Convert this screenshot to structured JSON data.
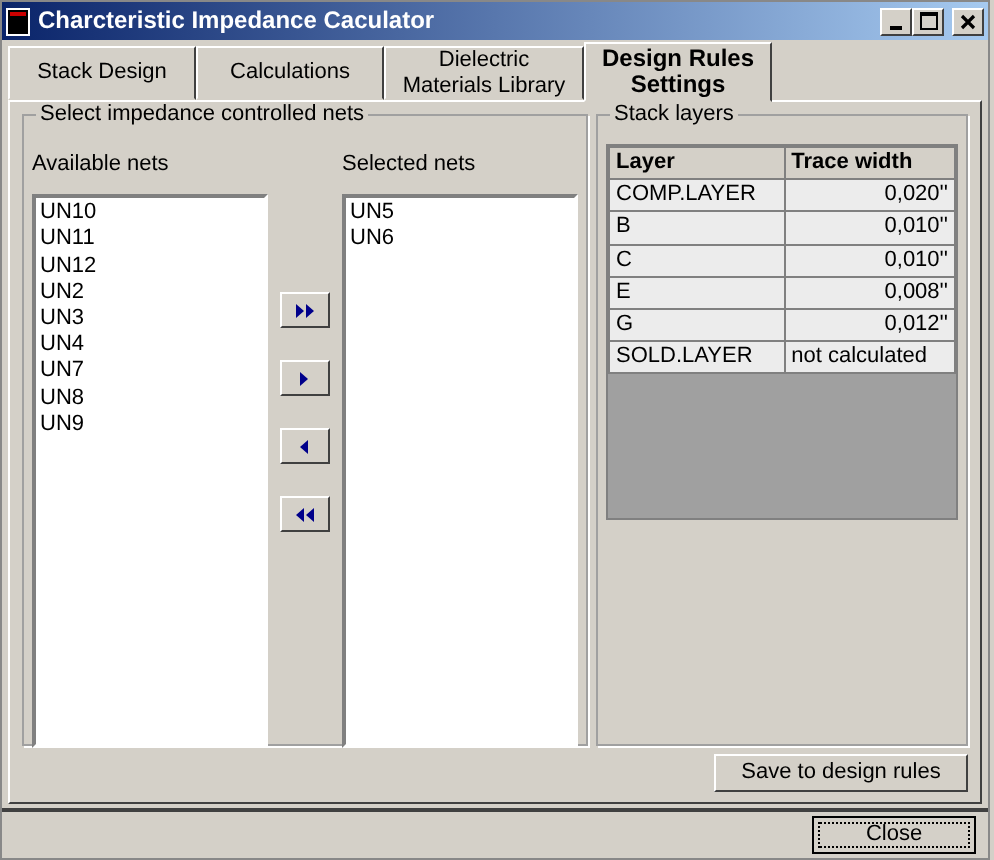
{
  "window": {
    "title": "Charcteristic Impedance Caculator"
  },
  "tabs": [
    {
      "label": "Stack Design",
      "selected": false
    },
    {
      "label": "Calculations",
      "selected": false
    },
    {
      "label": "Dielectric Materials Library",
      "selected": false
    },
    {
      "label": "Design Rules Settings",
      "selected": true
    }
  ],
  "nets_group": {
    "title": "Select impedance controlled nets",
    "available_label": "Available nets",
    "available": [
      "UN10",
      "UN11",
      "UN12",
      "UN2",
      "UN3",
      "UN4",
      "UN7",
      "UN8",
      "UN9"
    ],
    "selected_label": "Selected nets",
    "selected": [
      "UN5",
      "UN6"
    ]
  },
  "stack_group": {
    "title": "Stack layers",
    "columns": [
      "Layer",
      "Trace width"
    ],
    "rows": [
      [
        "COMP.LAYER",
        "0,020''"
      ],
      [
        "B",
        "0,010''"
      ],
      [
        "C",
        "0,010''"
      ],
      [
        "E",
        "0,008''"
      ],
      [
        "G",
        "0,012''"
      ],
      [
        "SOLD.LAYER",
        "not calculated"
      ]
    ]
  },
  "save_button": "Save to design rules",
  "close_button": "Close"
}
